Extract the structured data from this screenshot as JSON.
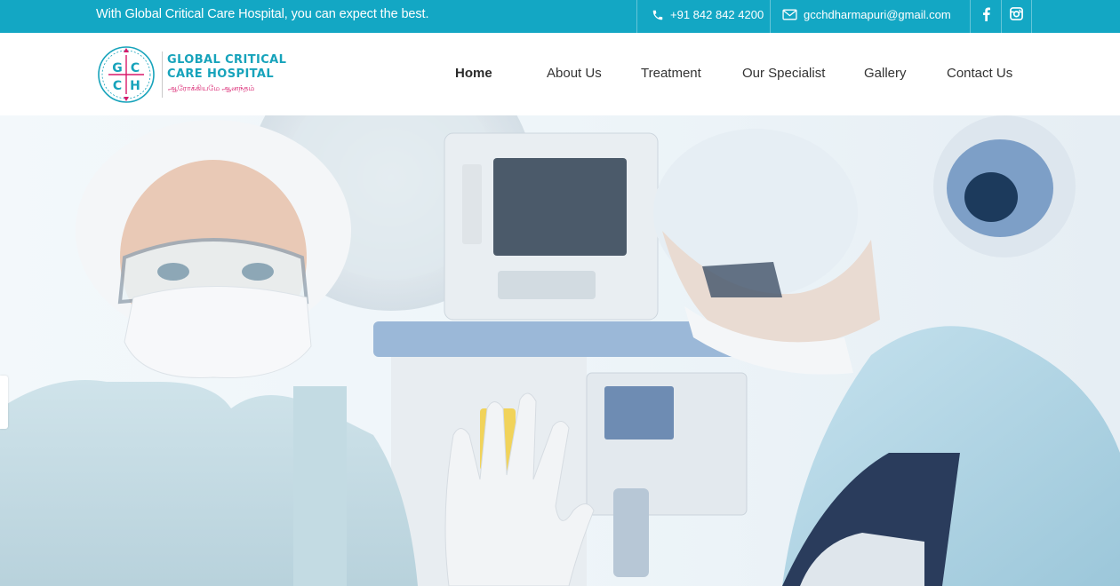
{
  "topbar": {
    "tagline": "With Global Critical Care Hospital, you can expect the best.",
    "phone": "+91 842 842 4200",
    "email": "gcchdharmapuri@gmail.com",
    "phone_icon": "phone-icon",
    "email_icon": "envelope-icon",
    "social": [
      "facebook-icon",
      "instagram-icon"
    ],
    "color": "#13a7c4"
  },
  "logo": {
    "letters": [
      "G",
      "C",
      "C",
      "H"
    ],
    "line1": "GLOBAL CRITICAL",
    "line2": "CARE HOSPITAL",
    "line3": "ஆரோக்கியமே ஆனந்தம்",
    "brand_color": "#17a3bb",
    "accent_color": "#d8196a"
  },
  "nav": {
    "items": [
      {
        "label": "Home",
        "active": true
      },
      {
        "label": "About Us"
      },
      {
        "label": "Treatment"
      },
      {
        "label": "Our Specialist"
      },
      {
        "label": "Gallery"
      },
      {
        "label": "Contact Us"
      }
    ]
  }
}
